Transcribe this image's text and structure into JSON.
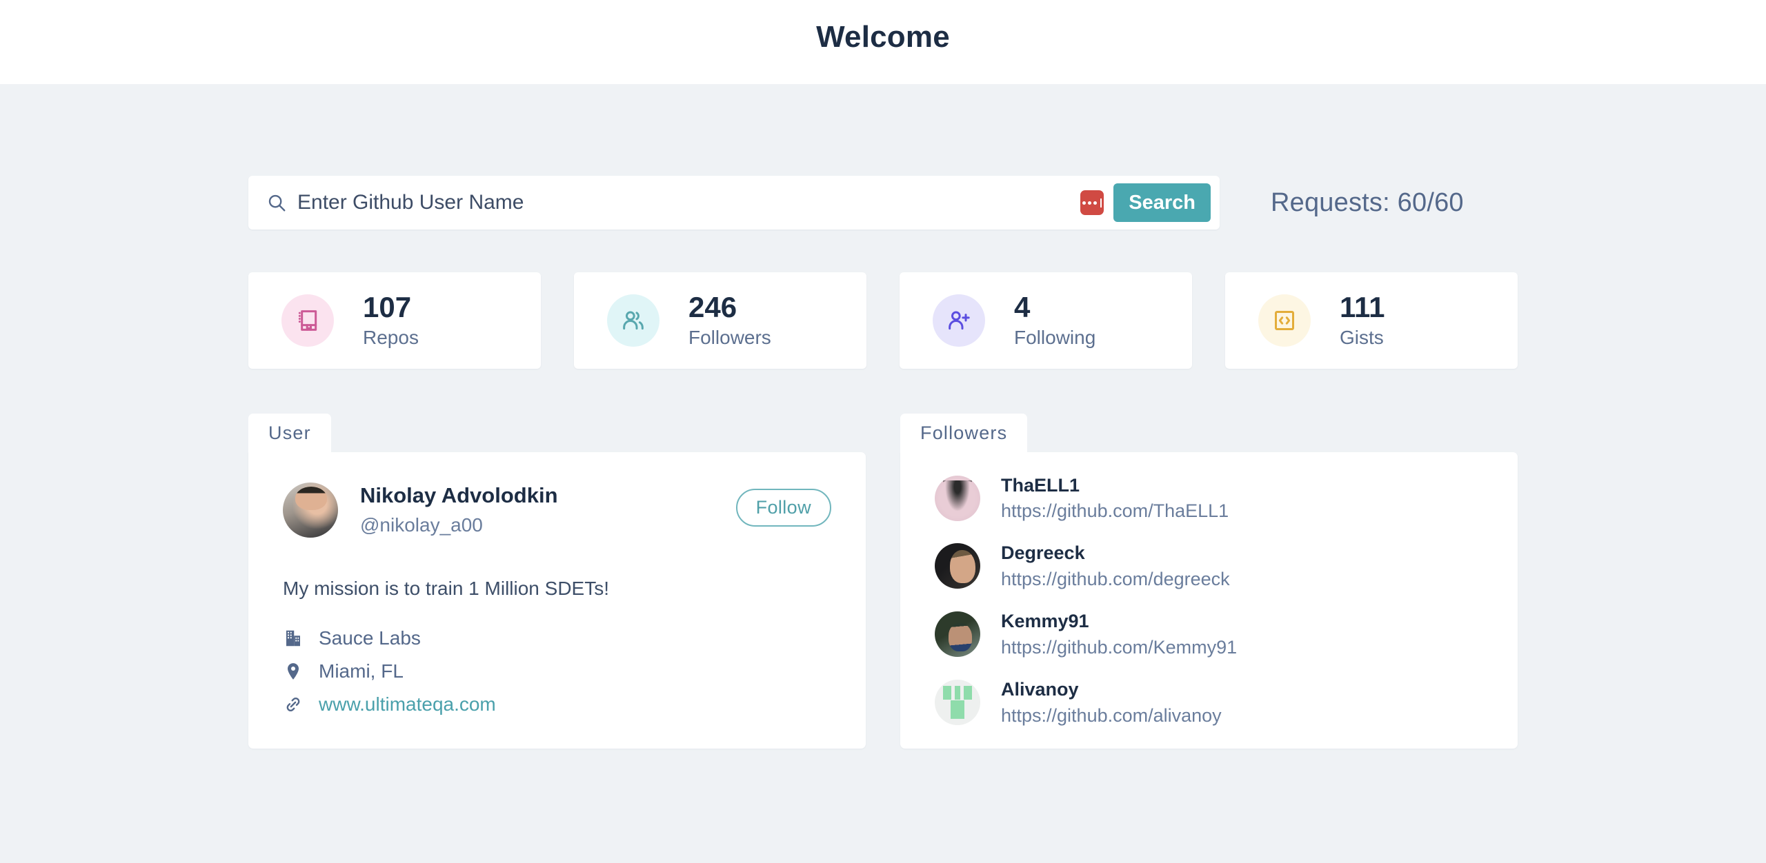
{
  "header": {
    "title": "Welcome"
  },
  "search": {
    "placeholder": "Enter Github User Name",
    "value": "",
    "button_label": "Search",
    "requests_label": "Requests: 60/60",
    "search_icon": "search-icon",
    "password_manager_icon": "password-manager-icon"
  },
  "stats": [
    {
      "value": "107",
      "label": "Repos",
      "icon": "book-icon",
      "icon_color": "#cc5a96",
      "bg_color": "#fbe3ef"
    },
    {
      "value": "246",
      "label": "Followers",
      "icon": "users-icon",
      "icon_color": "#58a7ae",
      "bg_color": "#e0f5f7"
    },
    {
      "value": "4",
      "label": "Following",
      "icon": "user-plus-icon",
      "icon_color": "#5b4ee0",
      "bg_color": "#e6e4fb"
    },
    {
      "value": "111",
      "label": "Gists",
      "icon": "code-icon",
      "icon_color": "#e3ad3a",
      "bg_color": "#fdf6e3"
    }
  ],
  "user_panel": {
    "tab_label": "User",
    "name": "Nikolay Advolodkin",
    "handle": "@nikolay_a00",
    "follow_label": "Follow",
    "bio": "My mission is to train 1 Million SDETs!",
    "company": "Sauce Labs",
    "location": "Miami, FL",
    "website": "www.ultimateqa.com",
    "company_icon": "building-icon",
    "location_icon": "map-pin-icon",
    "website_icon": "link-icon",
    "avatar_icon": "user-avatar"
  },
  "followers_panel": {
    "tab_label": "Followers",
    "items": [
      {
        "name": "ThaELL1",
        "url": "https://github.com/ThaELL1"
      },
      {
        "name": "Degreeck",
        "url": "https://github.com/degreeck"
      },
      {
        "name": "Kemmy91",
        "url": "https://github.com/Kemmy91"
      },
      {
        "name": "Alivanoy",
        "url": "https://github.com/alivanoy"
      }
    ]
  },
  "theme": {
    "page_bg": "#eff2f5",
    "card_bg": "#ffffff",
    "accent": "#4aa8b0",
    "text_dark": "#1d2d44",
    "text_muted": "#54688a"
  }
}
